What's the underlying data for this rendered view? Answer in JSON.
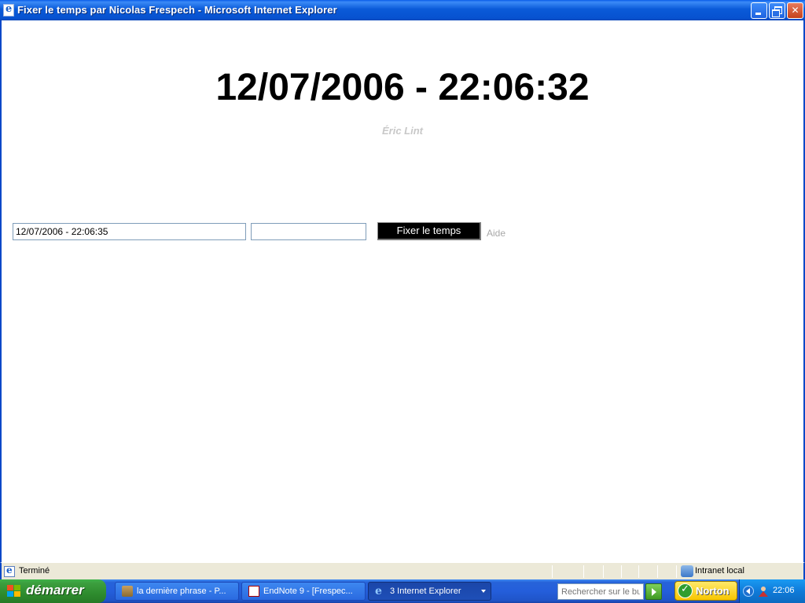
{
  "window": {
    "title": "Fixer le temps par Nicolas Frespech - Microsoft Internet Explorer"
  },
  "page": {
    "big_clock": "12/07/2006 - 22:06:32",
    "author": "Éric Lint",
    "date_input_value": "12/07/2006 - 22:06:35",
    "extra_input_value": "",
    "fix_button_label": "Fixer le temps",
    "help_link": "Aide"
  },
  "statusbar": {
    "status_text": "Terminé",
    "zone_text": "Intranet local"
  },
  "taskbar": {
    "start_label": "démarrer",
    "tasks": [
      {
        "label": "la dernière phrase - P...",
        "icon": "scroll-icon"
      },
      {
        "label": "EndNote 9 - [Frespec...",
        "icon": "endnote-icon"
      },
      {
        "label": "3 Internet Explorer",
        "icon": "ie-icon"
      }
    ],
    "search_placeholder": "Rechercher sur le bur",
    "norton_label": "Norton",
    "clock": "22:06"
  },
  "colors": {
    "titlebar_blue": "#0a5ad8",
    "author_gray": "#c8c8c8",
    "help_gray": "#a8a8a8",
    "start_green": "#3c9f3f",
    "norton_yellow": "#f7c600"
  }
}
